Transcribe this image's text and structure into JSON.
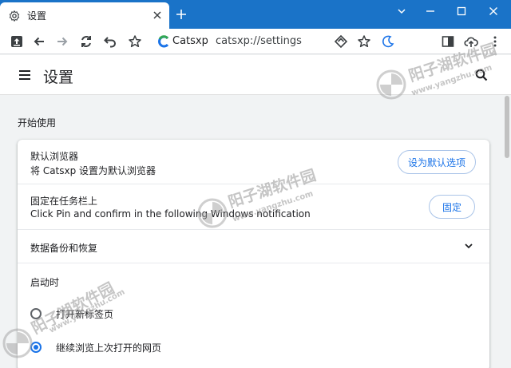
{
  "tab": {
    "title": "设置"
  },
  "address": {
    "brand": "Catsxp",
    "url": "catsxp://settings"
  },
  "header": {
    "title": "设置"
  },
  "section": {
    "title": "开始使用"
  },
  "rows": {
    "default_browser": {
      "title": "默认浏览器",
      "subtitle": "将 Catsxp 设置为默认浏览器",
      "button": "设为默认选项"
    },
    "pin_taskbar": {
      "title": "固定在任务栏上",
      "subtitle": "Click Pin and confirm in the following Windows notification",
      "button": "固定"
    },
    "backup": {
      "title": "数据备份和恢复"
    }
  },
  "startup": {
    "label": "启动时",
    "options": [
      {
        "label": "打开新标签页",
        "checked": false
      },
      {
        "label": "继续浏览上次打开的网页",
        "checked": true
      }
    ]
  },
  "watermark": {
    "text": "阳子湖软件园",
    "url": "www.yangzhu.com"
  },
  "colors": {
    "tabbar": "#1a73c8",
    "accent": "#1a73e8"
  }
}
